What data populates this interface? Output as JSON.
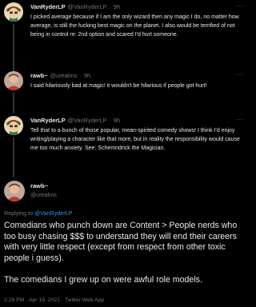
{
  "thread": [
    {
      "name": "VanRyderLP",
      "handle": "@VanRyderLP",
      "time": "9h",
      "text": "I picked average because if I am the only wizard then any magic I do, no matter how average, is still the fucking best magic on the planet. I also would be terrified of not being in control re: 2nd option and scared I'd hurt someone."
    },
    {
      "name": "rawb~",
      "handle": "@urealms",
      "time": "9h",
      "text": "I said hilariously bad at magic! it wouldn't be hilarious if people got hurt!"
    },
    {
      "name": "VanRyderLP",
      "handle": "@VanRyderLP",
      "time": "9h",
      "text": "Tell that to a bunch of those popular, mean-spirited comedy shows! I think I'd enjoy writing/playing a character like that more, but in reality the responsibility would cause me too much anxiety. See: Schemndrick the Magician."
    }
  ],
  "main": {
    "name": "rawb~",
    "handle": "@urealms",
    "replying_to_label": "Replying to",
    "replying_to_handle": "@VanRyderLP",
    "paragraph1": "Comedians who punch down are Content > People nerds who too busy chasing $$$ to understand they will end their careers with very little respect (except from respect from other toxic people i guess).",
    "paragraph2": "The comedians I grew up on were awful role models.",
    "meta": "2:28 PM · Apr 19, 2021 · Twitter Web App"
  },
  "ui": {
    "separator": "·",
    "more_label": "···"
  },
  "colors": {
    "background": "#000000",
    "text": "#e7e9ea",
    "secondary": "#71767b",
    "link": "#1d9bf0",
    "thread_line": "#2f3336"
  }
}
